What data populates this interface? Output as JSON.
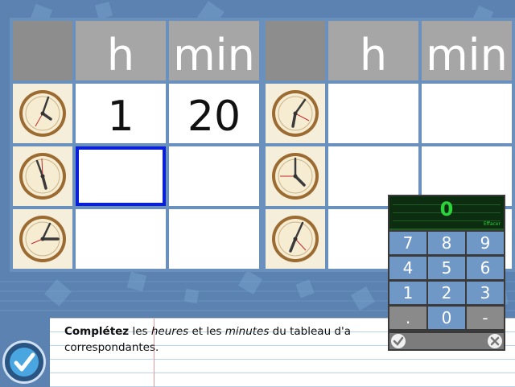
{
  "colors": {
    "background": "#5b82b0",
    "header_cell": "#a6a6a6",
    "selection": "#0a1fd8",
    "keypad_display_text": "#2bd43a",
    "keypad_key": "#6f98c6"
  },
  "tables": [
    {
      "headers": [
        "h",
        "min"
      ],
      "rows": [
        {
          "clock_icon": "clock-icon",
          "h": "1",
          "min": "20"
        },
        {
          "clock_icon": "clock-icon",
          "h": "",
          "min": ""
        },
        {
          "clock_icon": "clock-icon",
          "h": "",
          "min": ""
        }
      ]
    },
    {
      "headers": [
        "h",
        "min"
      ],
      "rows": [
        {
          "clock_icon": "clock-icon",
          "h": "",
          "min": ""
        },
        {
          "clock_icon": "clock-icon",
          "h": "",
          "min": ""
        },
        {
          "clock_icon": "clock-icon",
          "h": "",
          "min": ""
        }
      ]
    }
  ],
  "keypad": {
    "display": "0",
    "erase_label": "Effacer",
    "keys": [
      "7",
      "8",
      "9",
      "4",
      "5",
      "6",
      "1",
      "2",
      "3",
      ".",
      "0",
      "-"
    ],
    "ok_icon": "check-icon",
    "close_icon": "close-icon"
  },
  "instruction": {
    "bold": "Complétez",
    "t1": " les ",
    "i1": "heures",
    "t2": " et les ",
    "i2": "minutes",
    "t3": " du tableau d'a",
    "line2": "correspondantes."
  },
  "validate_icon": "check-icon"
}
